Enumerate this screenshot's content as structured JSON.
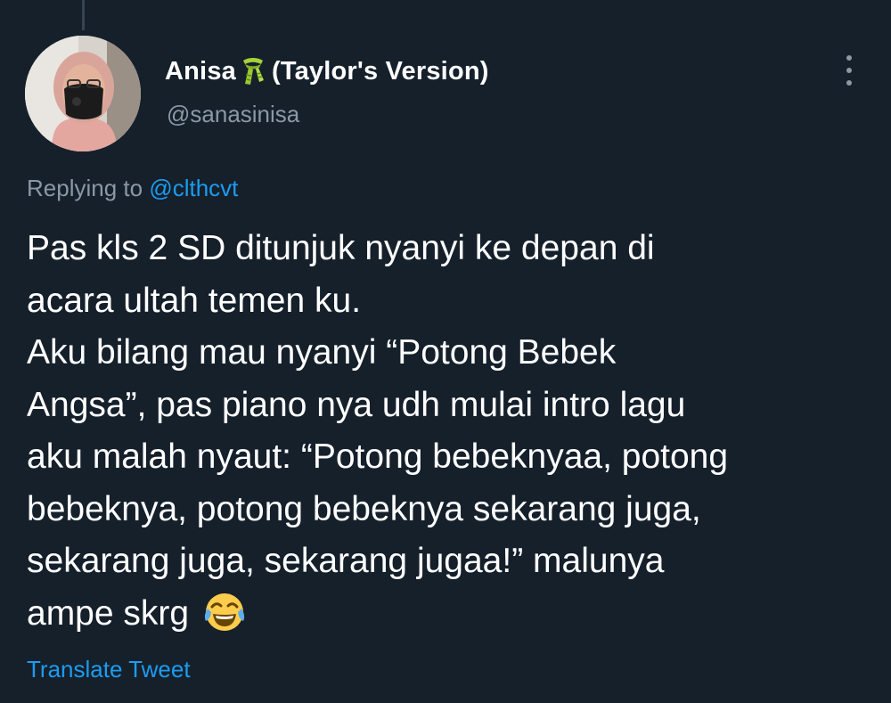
{
  "author": {
    "display_name_part1": "Anisa",
    "display_name_icon": "scarf-icon",
    "display_name_part2": "(Taylor's Version)",
    "handle": "@sanasinisa"
  },
  "reply": {
    "prefix": "Replying to ",
    "mention": "@clthcvt"
  },
  "tweet": {
    "text": "Pas kls 2 SD ditunjuk nyanyi ke depan di\nacara ultah temen ku.\nAku bilang mau nyanyi “Potong Bebek\nAngsa”, pas piano nya udh mulai intro lagu\naku malah nyaut: “Potong bebeknyaa, potong\nbebeknya, potong bebeknya sekarang juga,\nsekarang juga, sekarang jugaa!” malunya\nampe skrg",
    "emoji": "face-with-tears-of-joy-icon"
  },
  "actions": {
    "translate_label": "Translate Tweet",
    "more_icon": "more-options-icon"
  },
  "colors": {
    "background": "#15202b",
    "text": "#ffffff",
    "secondary": "#8b98a5",
    "accent": "#1d9bf0"
  }
}
